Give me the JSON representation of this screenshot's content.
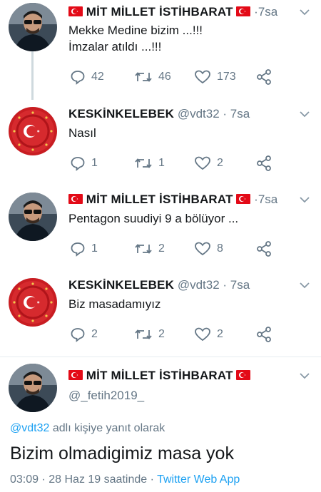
{
  "tweets": [
    {
      "name": "MİT MİLLET İSTİHBARAT",
      "handle": "",
      "time": "7sa",
      "text_lines": [
        "Mekke Medine bizim ...!!!",
        "İmzalar atıldı ...!!!"
      ],
      "replies": "42",
      "retweets": "46",
      "likes": "173",
      "avatar": "man-with-sunglasses"
    },
    {
      "name": "KESKİNKELEBEK",
      "handle": "@vdt32",
      "time": "7sa",
      "text_lines": [
        "Nasıl"
      ],
      "replies": "1",
      "retweets": "1",
      "likes": "2",
      "avatar": "turkish-flag-emblem"
    },
    {
      "name": "MİT MİLLET İSTİHBARAT",
      "handle": "",
      "time": "7sa",
      "text_lines": [
        "Pentagon suudiyi 9 a bölüyor ..."
      ],
      "replies": "1",
      "retweets": "2",
      "likes": "8",
      "avatar": "man-with-sunglasses"
    },
    {
      "name": "KESKİNKELEBEK",
      "handle": "@vdt32",
      "time": "7sa",
      "text_lines": [
        "Biz masadamıyız"
      ],
      "replies": "2",
      "retweets": "2",
      "likes": "2",
      "avatar": "turkish-flag-emblem"
    }
  ],
  "main_tweet": {
    "name": "MİT MİLLET İSTİHBARAT",
    "handle": "@_fetih2019_",
    "reply_prefix": "@vdt32",
    "reply_suffix": "adlı kişiye yanıt olarak",
    "text": "Bizim olmadigimiz masa yok",
    "timestamp": "03:09 · 28 Haz 19 saatinde ·",
    "app": "Twitter Web App"
  },
  "icons": {
    "reply": "reply-icon",
    "retweet": "retweet-icon",
    "like": "heart-icon",
    "share": "share-icon",
    "flag": "turkey-flag-icon",
    "menu": "chevron-down-icon"
  },
  "colors": {
    "text": "#14171a",
    "muted": "#657786",
    "link": "#1da1f2",
    "flag_red": "#e30a17",
    "thread_line": "#cfd9de"
  }
}
